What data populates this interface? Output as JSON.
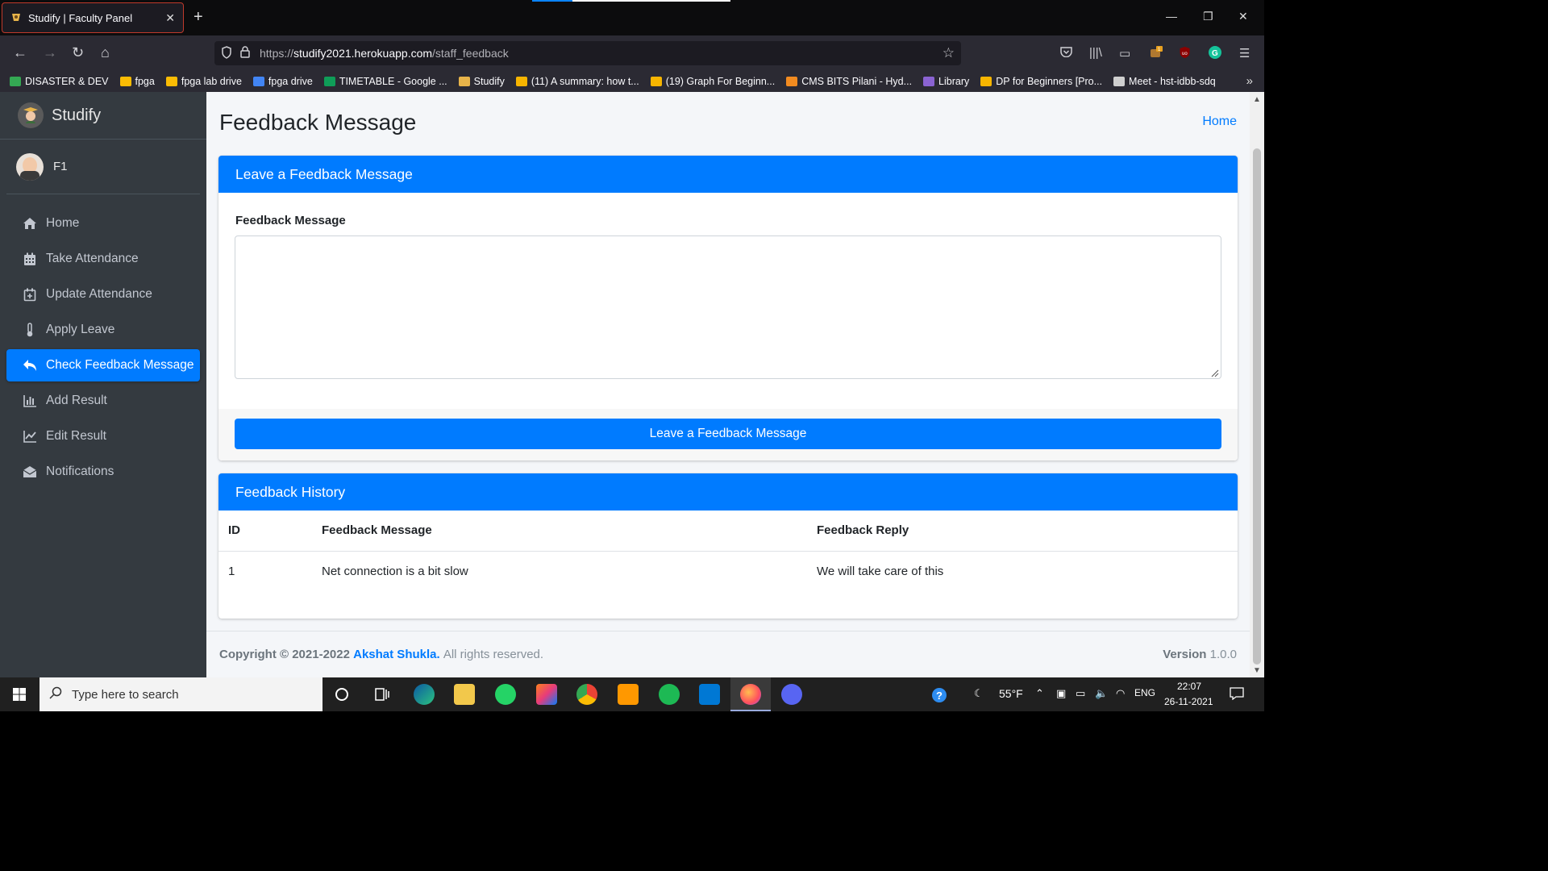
{
  "browser": {
    "tab_title": "Studify | Faculty Panel",
    "url_prefix": "https://",
    "url_host": "studify2021.herokuapp.com",
    "url_path": "/staff_feedback",
    "bookmarks": [
      {
        "label": "DISASTER & DEV",
        "color": "#34a853"
      },
      {
        "label": "fpga",
        "color": "#fbbc04"
      },
      {
        "label": "fpga lab drive",
        "color": "#fbbc04"
      },
      {
        "label": "fpga drive",
        "color": "#4285f4"
      },
      {
        "label": "TIMETABLE - Google ...",
        "color": "#0f9d58"
      },
      {
        "label": "Studify",
        "color": "#e8b44a"
      },
      {
        "label": "(11) A summary: how t...",
        "color": "#f7b500"
      },
      {
        "label": "(19) Graph For Beginn...",
        "color": "#f7b500"
      },
      {
        "label": "CMS BITS Pilani - Hyd...",
        "color": "#f28b20"
      },
      {
        "label": "Library",
        "color": "#8a63d2"
      },
      {
        "label": "DP for Beginners [Pro...",
        "color": "#f7b500"
      },
      {
        "label": "Meet - hst-idbb-sdq",
        "color": "#cfcfcf"
      }
    ]
  },
  "sidebar": {
    "brand": "Studify",
    "user": "F1",
    "items": [
      {
        "label": "Home",
        "icon": "home-icon"
      },
      {
        "label": "Take Attendance",
        "icon": "calendar-icon"
      },
      {
        "label": "Update Attendance",
        "icon": "calendar-plus-icon"
      },
      {
        "label": "Apply Leave",
        "icon": "thermometer-icon"
      },
      {
        "label": "Check Feedback Message",
        "icon": "reply-icon",
        "active": true
      },
      {
        "label": "Add Result",
        "icon": "bar-chart-icon"
      },
      {
        "label": "Edit Result",
        "icon": "line-chart-icon"
      },
      {
        "label": "Notifications",
        "icon": "envelope-open-icon"
      }
    ]
  },
  "main": {
    "title": "Feedback Message",
    "breadcrumb": "Home",
    "form_card": {
      "header": "Leave a Feedback Message",
      "label": "Feedback Message",
      "textarea_value": "",
      "button": "Leave a Feedback Message"
    },
    "history_card": {
      "header": "Feedback History",
      "columns": [
        "ID",
        "Feedback Message",
        "Feedback Reply"
      ],
      "rows": [
        [
          "1",
          "Net connection is a bit slow",
          "We will take care of this"
        ]
      ]
    }
  },
  "footer": {
    "copyright": "Copyright © 2021-2022",
    "author": "Akshat Shukla.",
    "rights": "All rights reserved.",
    "version_label": "Version",
    "version": "1.0.0"
  },
  "taskbar": {
    "search_placeholder": "Type here to search",
    "weather": "55°F",
    "lang": "ENG",
    "time": "22:07",
    "date": "26-11-2021"
  },
  "colors": {
    "primary": "#007bff",
    "sidebar_bg": "#343a40",
    "page_bg": "#f4f6f9"
  }
}
